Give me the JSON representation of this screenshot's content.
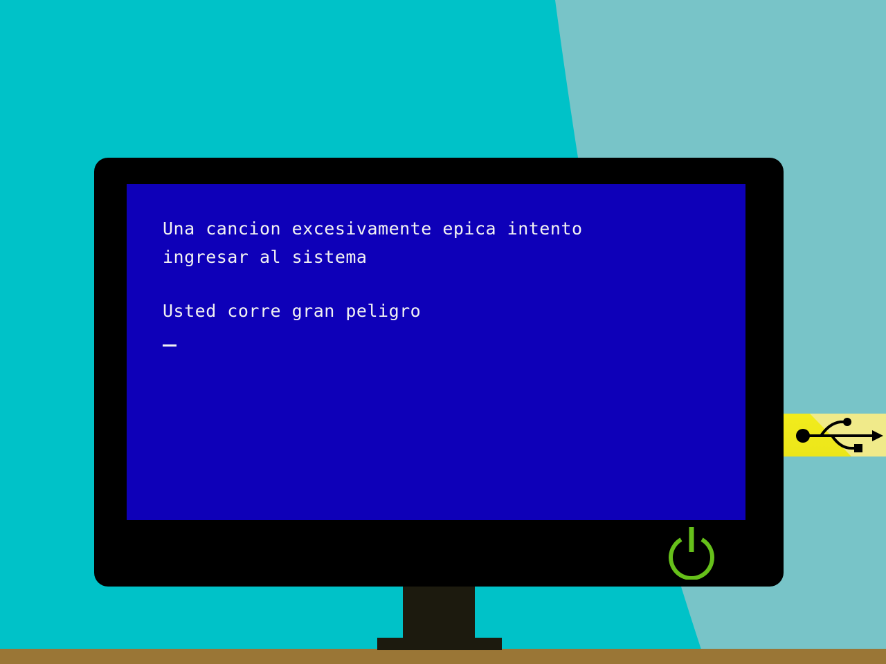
{
  "screen": {
    "lines": [
      "Una cancion excesivamente epica intento",
      "ingresar al sistema"
    ],
    "warning": "Usted corre gran peligro",
    "cursor": "_"
  },
  "colors": {
    "background": "#00c2c8",
    "background_light": "#78c4c8",
    "screen": "#0e00b8",
    "text": "#f2f2f2",
    "power": "#66c01a",
    "usb": "#f2ec1c",
    "desk": "#9a7636"
  },
  "icons": {
    "power": "power-icon",
    "usb": "usb-icon"
  }
}
